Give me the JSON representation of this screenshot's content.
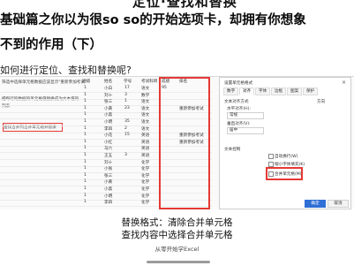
{
  "header": {
    "top_title": "定位·查找和替换",
    "headline_line1": "基础篇之你以为很so so的开始选项卡，却拥有你想象",
    "headline_line2": "不到的作用（下）",
    "question": "如何进行定位、查找和替换呢?"
  },
  "sheet": {
    "columns": [
      "班级",
      "姓名",
      "学号",
      "考试科目",
      "成绩",
      "排名"
    ],
    "rows": [
      [
        "1",
        "小白",
        "17",
        "语文",
        "95",
        ""
      ],
      [
        "1",
        "刘十",
        "3",
        "数学",
        "",
        ""
      ],
      [
        "1",
        "张三",
        "1",
        "语文",
        "",
        ""
      ],
      [
        "1",
        "小黄",
        "23",
        "语文",
        "",
        "重新参加考试"
      ],
      [
        "1",
        "小黑",
        "",
        "语文",
        "",
        ""
      ],
      [
        "1",
        "小明",
        "35",
        "语文",
        "",
        ""
      ],
      [
        "1",
        "李四",
        "2",
        "语文",
        "",
        ""
      ],
      [
        "1",
        "小花",
        "15",
        "英语",
        "",
        "重新参加考试"
      ],
      [
        "1",
        "小红",
        "",
        "英语",
        "",
        "重新参加考试"
      ],
      [
        "1",
        "马六",
        "",
        "英语",
        "",
        ""
      ],
      [
        "1",
        "王五",
        "3",
        "英语",
        "",
        ""
      ],
      [
        "1",
        "刘十",
        "",
        "化学",
        "",
        ""
      ],
      [
        "1",
        "小张",
        "",
        "化学",
        "",
        ""
      ],
      [
        "1",
        "张三",
        "",
        "化学",
        "",
        ""
      ],
      [
        "1",
        "小黄",
        "",
        "化学",
        "",
        ""
      ],
      [
        "1",
        "小黑",
        "",
        "化学",
        "",
        ""
      ],
      [
        "1",
        "小明",
        "",
        "化学",
        "",
        ""
      ],
      [
        "1",
        "李四",
        "",
        "化学",
        "",
        ""
      ]
    ],
    "left_notes": [
      "筛选中选择单元格数据应该显示\"重新参加考试\"",
      "把每行的数据的单元格值替换成为文本值的",
      "列表",
      "查找合并列合并单元格并替换"
    ]
  },
  "dialog": {
    "title": "设置单元格格式",
    "close": "×",
    "tabs": [
      "数字",
      "对齐",
      "字体",
      "边框",
      "图案",
      "保护"
    ],
    "text_align_label": "文本对齐方式",
    "horizontal_label": "水平对齐(H):",
    "horizontal_value": "常规",
    "vertical_label": "垂直对齐(V):",
    "vertical_value": "居中",
    "text_control_label": "文本控制",
    "wrap_label": "自动换行(W)",
    "shrink_label": "缩小字体填充(K)",
    "merge_label": "合并单元格(M)",
    "direction_label": "方向",
    "ok": "确定",
    "cancel": "取消"
  },
  "captions": {
    "line1": "替换格式：清除合并单元格",
    "line2": "查找内容中选择合并单元格"
  },
  "footer": "从零开始学Excel"
}
